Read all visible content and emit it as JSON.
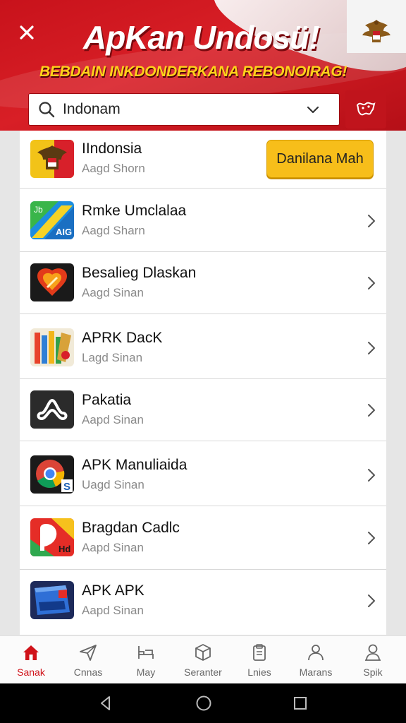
{
  "header": {
    "title": "ApKan Undosü!",
    "subtitle": "BEBDAIN INKDONDERKANA REBONOIRAG!",
    "close_icon": "close-icon",
    "emblem_icon": "garuda-emblem-icon",
    "colors": {
      "primary": "#d81f26",
      "accent": "#ffd21a"
    }
  },
  "search": {
    "value": "Indonam",
    "placeholder": "",
    "search_icon": "search-icon",
    "dropdown_icon": "chevron-down-icon",
    "map_icon": "map-icon"
  },
  "apps": [
    {
      "name": "IIndonsia",
      "sub": "Aagd Shorn",
      "action": "Danilana Mah",
      "icon": "garuda-app-icon"
    },
    {
      "name": "Rmke Umclalaa",
      "sub": "Aagd Sharn",
      "icon": "aig-app-icon"
    },
    {
      "name": "Besalieg Dlaskan",
      "sub": "Aagd Sinan",
      "icon": "flame-app-icon"
    },
    {
      "name": "APRK DacK",
      "sub": "Lagd Sinan",
      "icon": "pencils-app-icon"
    },
    {
      "name": "Pakatia",
      "sub": "Aapd Sinan",
      "icon": "link-app-icon"
    },
    {
      "name": "APK Manuliaida",
      "sub": "Uagd Sinan",
      "icon": "browser-app-icon"
    },
    {
      "name": "Bragdan Cadlc",
      "sub": "Aapd Sinan",
      "icon": "hd-app-icon"
    },
    {
      "name": "APK APK",
      "sub": "Aapd Sinan",
      "icon": "box-app-icon"
    }
  ],
  "tabs": [
    {
      "label": "Sanak",
      "icon": "home-icon",
      "active": true
    },
    {
      "label": "Cnnas",
      "icon": "send-icon"
    },
    {
      "label": "May",
      "icon": "bed-icon"
    },
    {
      "label": "Seranter",
      "icon": "cube-icon"
    },
    {
      "label": "Lnies",
      "icon": "clipboard-icon"
    },
    {
      "label": "Marans",
      "icon": "person-icon"
    },
    {
      "label": "Spik",
      "icon": "profile-icon"
    }
  ],
  "system_nav": {
    "back_icon": "back-icon",
    "home_icon": "home-circle-icon",
    "recents_icon": "recents-icon"
  }
}
